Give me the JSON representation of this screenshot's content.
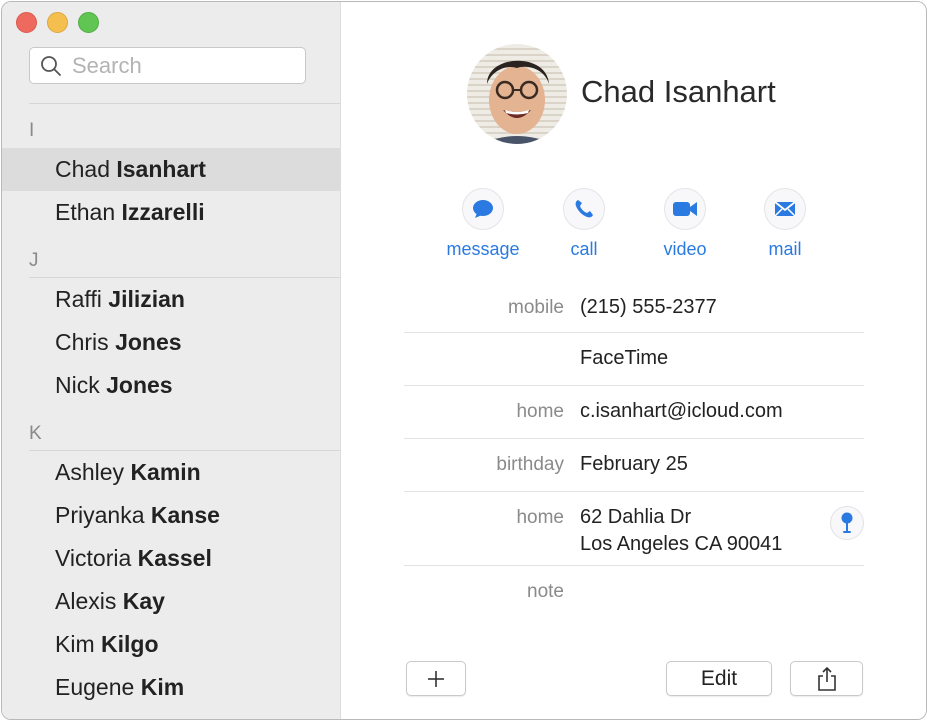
{
  "window": {
    "controls": [
      "close",
      "minimize",
      "zoom"
    ]
  },
  "sidebar": {
    "search": {
      "placeholder": "Search",
      "value": "",
      "icon": "search-icon"
    },
    "sections": [
      {
        "letter": "I",
        "contacts": [
          {
            "first": "Chad",
            "last": "Isanhart",
            "selected": true
          },
          {
            "first": "Ethan",
            "last": "Izzarelli",
            "selected": false
          }
        ]
      },
      {
        "letter": "J",
        "contacts": [
          {
            "first": "Raffi",
            "last": "Jilizian",
            "selected": false
          },
          {
            "first": "Chris",
            "last": "Jones",
            "selected": false
          },
          {
            "first": "Nick",
            "last": "Jones",
            "selected": false
          }
        ]
      },
      {
        "letter": "K",
        "contacts": [
          {
            "first": "Ashley",
            "last": "Kamin",
            "selected": false
          },
          {
            "first": "Priyanka",
            "last": "Kanse",
            "selected": false
          },
          {
            "first": "Victoria",
            "last": "Kassel",
            "selected": false
          },
          {
            "first": "Alexis",
            "last": "Kay",
            "selected": false
          },
          {
            "first": "Kim",
            "last": "Kilgo",
            "selected": false
          },
          {
            "first": "Eugene",
            "last": "Kim",
            "selected": false
          }
        ]
      }
    ]
  },
  "detail": {
    "name": "Chad Isanhart",
    "avatar": "contact-photo",
    "actions": [
      {
        "id": "message",
        "label": "message",
        "icon": "message-bubble-icon"
      },
      {
        "id": "call",
        "label": "call",
        "icon": "phone-icon"
      },
      {
        "id": "video",
        "label": "video",
        "icon": "video-camera-icon"
      },
      {
        "id": "mail",
        "label": "mail",
        "icon": "envelope-icon"
      }
    ],
    "fields": [
      {
        "label": "mobile",
        "value": "(215) 555-2377"
      },
      {
        "label": "",
        "value": "FaceTime"
      },
      {
        "label": "home",
        "value": "c.isanhart@icloud.com"
      },
      {
        "label": "birthday",
        "value": "February 25"
      },
      {
        "label": "home",
        "value_line1": "62 Dahlia Dr",
        "value_line2": "Los Angeles CA 90041",
        "icon": "map-pin-icon"
      },
      {
        "label": "note",
        "value": ""
      }
    ]
  },
  "footer": {
    "add_label": "+",
    "edit_label": "Edit",
    "share_icon": "share-icon"
  },
  "colors": {
    "accent": "#2a7ae2",
    "sidebar_bg": "#ececec",
    "selected_bg": "#dcdcdc",
    "close": "#ee6a5e",
    "minimize": "#f5bf4f",
    "maximize": "#61c554"
  }
}
